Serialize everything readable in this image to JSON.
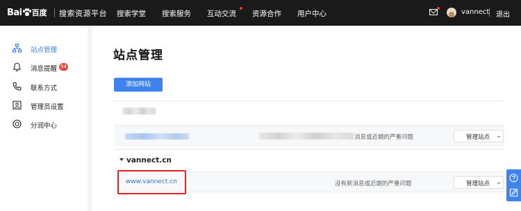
{
  "header": {
    "logo_bai": "Bai",
    "logo_du": "百度",
    "app_title": "搜索资源平台",
    "nav": [
      {
        "label": "搜索学堂",
        "has_dot": false
      },
      {
        "label": "搜索服务",
        "has_dot": false
      },
      {
        "label": "互动交流",
        "has_dot": true
      },
      {
        "label": "资源合作",
        "has_dot": false
      },
      {
        "label": "用户中心",
        "has_dot": false
      }
    ],
    "username": "vannect",
    "logout": "退出",
    "icons": {
      "mail": "mail-icon",
      "avatar": "avatar"
    }
  },
  "sidebar": {
    "items": [
      {
        "label": "站点管理",
        "icon": "sitemap-icon",
        "active": true
      },
      {
        "label": "消息提醒",
        "icon": "bell-icon",
        "badge": "54"
      },
      {
        "label": "联系方式",
        "icon": "phone-icon"
      },
      {
        "label": "管理员设置",
        "icon": "admin-icon"
      },
      {
        "label": "分润中心",
        "icon": "coin-icon"
      }
    ]
  },
  "main": {
    "title": "站点管理",
    "add_button": "添加网站",
    "groups": [
      {
        "name": "",
        "sites": [
          {
            "url": "",
            "message": "消息或近期的严重问题",
            "manage": "管理站点"
          }
        ]
      },
      {
        "name": "vannect.cn",
        "sites": [
          {
            "url": "www.vannect.cn",
            "message": "没有新消息或近期的严重问题",
            "manage": "管理站点"
          }
        ]
      }
    ]
  },
  "colors": {
    "accent": "#3e83ee",
    "topbar": "#1a1a1a",
    "highlight": "#e0231c",
    "badge": "#e8463a"
  }
}
